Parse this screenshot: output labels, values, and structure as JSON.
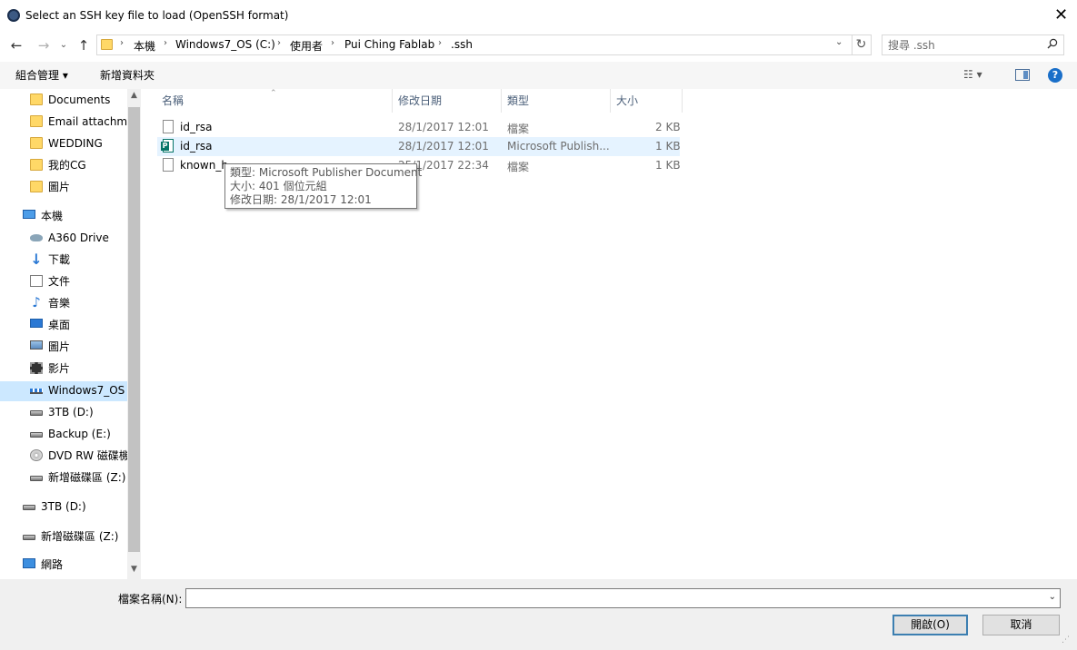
{
  "window": {
    "title": "Select an SSH key file to load (OpenSSH format)",
    "close": "✕"
  },
  "address": {
    "crumbs": [
      "本機",
      "Windows7_OS (C:)",
      "使用者",
      "Pui Ching Fablab",
      ".ssh"
    ],
    "search_placeholder": "搜尋 .ssh"
  },
  "toolbar": {
    "organize": "組合管理 ▾",
    "new_folder": "新增資料夾",
    "help": "?"
  },
  "nav": {
    "items": [
      {
        "label": "Documents",
        "icon": "folder-icon"
      },
      {
        "label": "Email attachme",
        "icon": "folder-icon"
      },
      {
        "label": "WEDDING",
        "icon": "folder-icon"
      },
      {
        "label": "我的CG",
        "icon": "folder-icon"
      },
      {
        "label": "圖片",
        "icon": "folder-icon"
      },
      {
        "label": "本機",
        "icon": "computer-icon"
      },
      {
        "label": "A360 Drive",
        "icon": "cloud-drive-icon"
      },
      {
        "label": "下載",
        "icon": "download-icon"
      },
      {
        "label": "文件",
        "icon": "document-icon"
      },
      {
        "label": "音樂",
        "icon": "music-icon"
      },
      {
        "label": "桌面",
        "icon": "desktop-icon"
      },
      {
        "label": "圖片",
        "icon": "pictures-icon"
      },
      {
        "label": "影片",
        "icon": "videos-icon"
      },
      {
        "label": "Windows7_OS (",
        "icon": "windows-drive-icon"
      },
      {
        "label": "3TB (D:)",
        "icon": "drive-icon"
      },
      {
        "label": "Backup (E:)",
        "icon": "drive-icon"
      },
      {
        "label": "DVD RW 磁碟機",
        "icon": "dvd-drive-icon"
      },
      {
        "label": "新增磁碟區 (Z:)",
        "icon": "drive-icon"
      },
      {
        "label": "3TB (D:)",
        "icon": "drive-icon"
      },
      {
        "label": "新增磁碟區 (Z:)",
        "icon": "drive-icon"
      },
      {
        "label": "網路",
        "icon": "network-icon"
      }
    ]
  },
  "files": {
    "columns": [
      "名稱",
      "修改日期",
      "類型",
      "大小"
    ],
    "rows": [
      {
        "name": "id_rsa",
        "modified": "28/1/2017 12:01",
        "type": "檔案",
        "size": "2 KB",
        "icon": "file-icon"
      },
      {
        "name": "id_rsa",
        "modified": "28/1/2017 12:01",
        "type": "Microsoft Publish...",
        "size": "1 KB",
        "icon": "publisher-file-icon"
      },
      {
        "name": "known_h",
        "modified": "25/1/2017 22:34",
        "type": "檔案",
        "size": "1 KB",
        "icon": "file-icon"
      }
    ]
  },
  "tooltip": {
    "line1": "類型: Microsoft Publisher Document",
    "line2": "大小: 401 個位元組",
    "line3": "修改日期: 28/1/2017 12:01"
  },
  "bottom": {
    "filename_label": "檔案名稱(N):",
    "filename_value": "",
    "open": "開啟(O)",
    "cancel": "取消"
  }
}
